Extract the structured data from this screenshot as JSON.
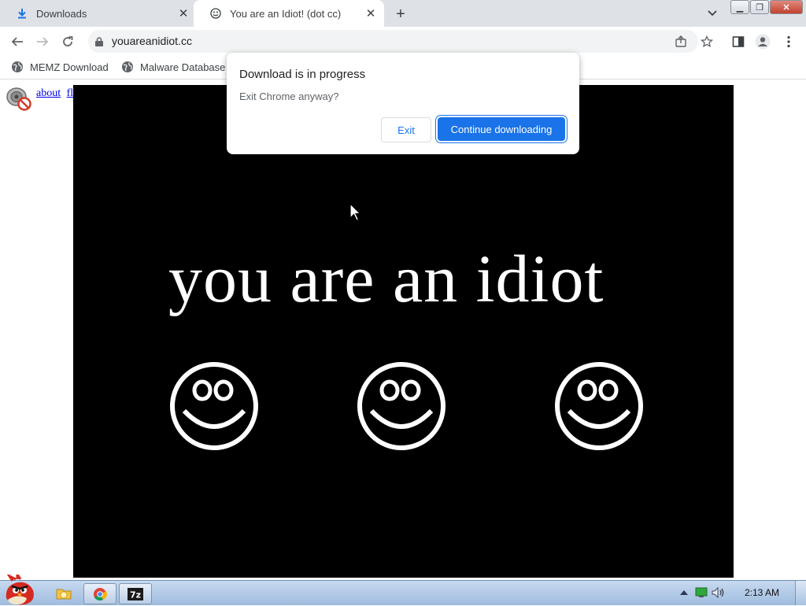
{
  "browser": {
    "tabs": [
      {
        "label": "Downloads",
        "icon": "download-icon"
      },
      {
        "label": "You are an Idiot! (dot cc)",
        "icon": "smiley-icon"
      }
    ],
    "url": "youareanidiot.cc",
    "bookmarks": [
      {
        "label": "MEMZ Download"
      },
      {
        "label": "Malware Database"
      }
    ]
  },
  "page": {
    "links": [
      "about",
      "flash"
    ],
    "headline": "you are an idiot",
    "background_color": "#000000",
    "text_color": "#ffffff"
  },
  "dialog": {
    "title": "Download is in progress",
    "message": "Exit Chrome anyway?",
    "exit_label": "Exit",
    "continue_label": "Continue downloading",
    "accent": "#1a73e8"
  },
  "taskbar": {
    "clock": "2:13 AM",
    "pinned": [
      "folder-icon",
      "chrome-icon",
      "7zip-icon"
    ],
    "tray": [
      "arrow-up-icon",
      "network-icon",
      "volume-icon"
    ]
  }
}
